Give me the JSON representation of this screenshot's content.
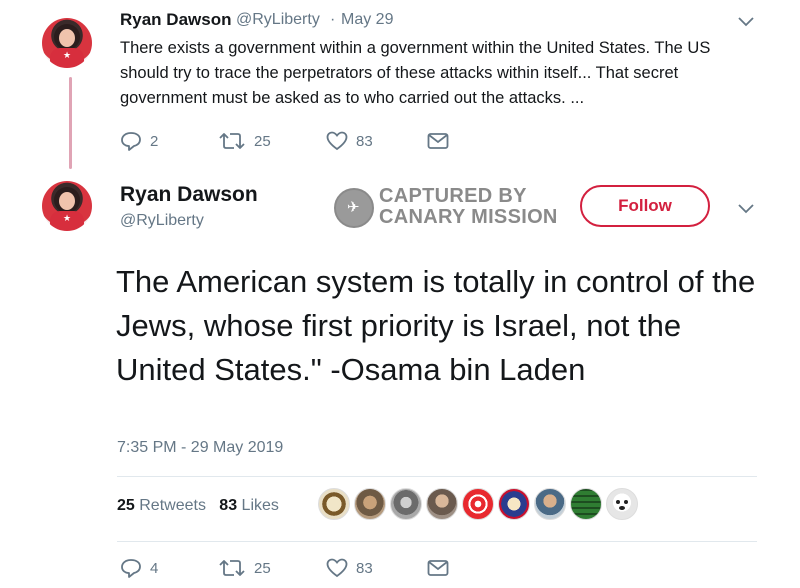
{
  "tweet1": {
    "name": "Ryan Dawson",
    "handle": "@RyLiberty",
    "separator": "·",
    "date": "May 29",
    "text": "There exists a government within a government within the United States. The US should try  to trace the perpetrators of these attacks within itself... That secret government must be asked as to who carried out  the attacks. ...",
    "replies": "2",
    "retweets": "25",
    "likes": "83"
  },
  "tweet2": {
    "name": "Ryan Dawson",
    "handle": "@RyLiberty",
    "follow_label": "Follow",
    "text": "The American system is totally in control of the Jews, whose first priority is Israel, not  the United States.\" -Osama bin Laden",
    "timestamp": "7:35 PM - 29 May 2019",
    "retweets_count": "25",
    "retweets_label": "Retweets",
    "likes_count": "83",
    "likes_label": "Likes",
    "replies": "4",
    "retweets": "25",
    "likes": "83"
  },
  "watermark": {
    "line1": "CAPTURED BY",
    "line2": "CANARY MISSION"
  },
  "colors": {
    "follow": "#d3203f",
    "muted": "#657786",
    "text": "#14171a",
    "thread_line": "#e0a4b5"
  },
  "icons": [
    "chevron-down-icon",
    "reply-icon",
    "retweet-icon",
    "like-icon",
    "dm-icon",
    "canary-bird-icon"
  ]
}
